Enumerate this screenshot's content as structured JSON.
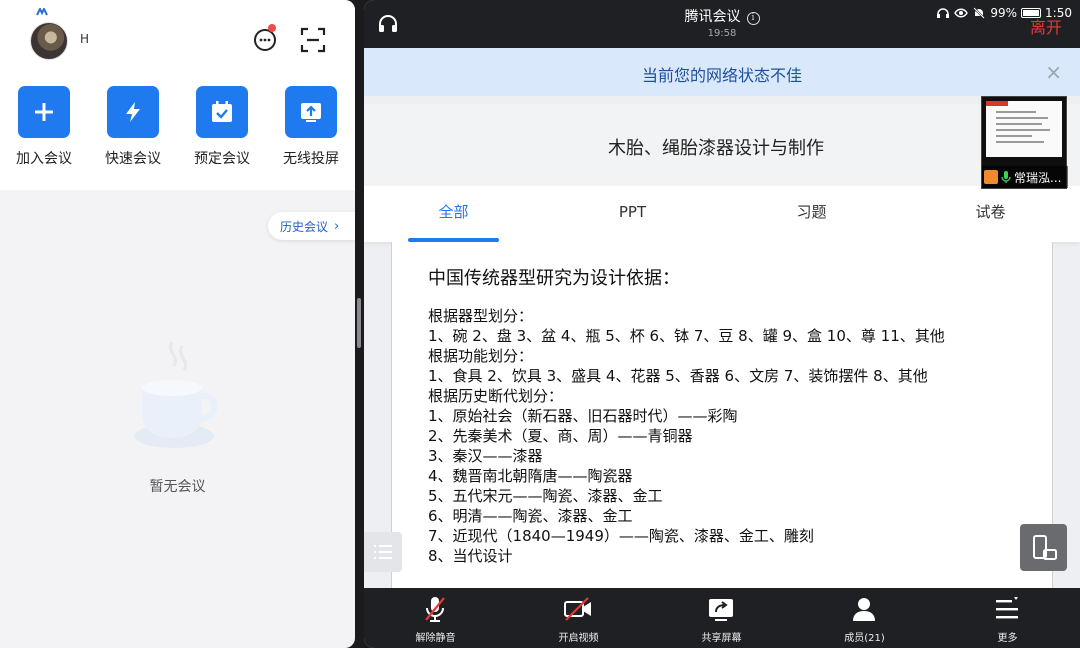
{
  "left": {
    "user_name": "H",
    "actions": [
      {
        "label": "加入会议",
        "icon": "plus-icon"
      },
      {
        "label": "快速会议",
        "icon": "lightning-icon"
      },
      {
        "label": "预定会议",
        "icon": "calendar-check-icon"
      },
      {
        "label": "无线投屏",
        "icon": "screen-cast-icon"
      }
    ],
    "history_label": "历史会议",
    "history_chevron": "›",
    "empty_text": "暂无会议"
  },
  "right": {
    "title": "腾讯会议",
    "info_glyph": "i",
    "meeting_time": "19:58",
    "status": {
      "battery": "99%",
      "battery_level": 0.99,
      "clock": "1:50"
    },
    "leave_label": "离开",
    "network_banner": "当前您的网络状态不佳",
    "close_glyph": "×",
    "doc_title": "木胎、绳胎漆器设计与制作",
    "tabs": [
      {
        "label": "全部",
        "active": true
      },
      {
        "label": "PPT",
        "active": false
      },
      {
        "label": "习题",
        "active": false
      },
      {
        "label": "试卷",
        "active": false
      }
    ],
    "participant": {
      "name": "常瑞泓..."
    },
    "slide": {
      "heading": "中国传统器型研究为设计依据：",
      "lines": [
        "根据器型划分：",
        "1、碗 2、盘 3、盆 4、瓶 5、杯 6、钵 7、豆 8、罐 9、盒 10、尊 11、其他",
        "根据功能划分：",
        "1、食具 2、饮具 3、盛具 4、花器 5、香器 6、文房 7、装饰摆件 8、其他",
        "根据历史断代划分：",
        "1、原始社会（新石器、旧石器时代）——彩陶",
        "2、先秦美术（夏、商、周）——青铜器",
        "3、秦汉——漆器",
        "4、魏晋南北朝隋唐——陶瓷器",
        "5、五代宋元——陶瓷、漆器、金工",
        "6、明清——陶瓷、漆器、金工",
        "7、近现代（1840—1949）——陶瓷、漆器、金工、雕刻",
        "8、当代设计"
      ]
    },
    "toolbar": [
      {
        "label": "解除静音",
        "icon": "mic-muted-icon"
      },
      {
        "label": "开启视频",
        "icon": "camera-off-icon"
      },
      {
        "label": "共享屏幕",
        "icon": "share-screen-icon"
      },
      {
        "label": "成员(21)",
        "icon": "members-icon"
      },
      {
        "label": "更多",
        "icon": "more-menu-icon"
      }
    ]
  },
  "colors": {
    "accent": "#1f7aef",
    "leave": "#e53935",
    "banner_bg": "#d9e8fb",
    "toolbar_bg": "#1f2023"
  }
}
